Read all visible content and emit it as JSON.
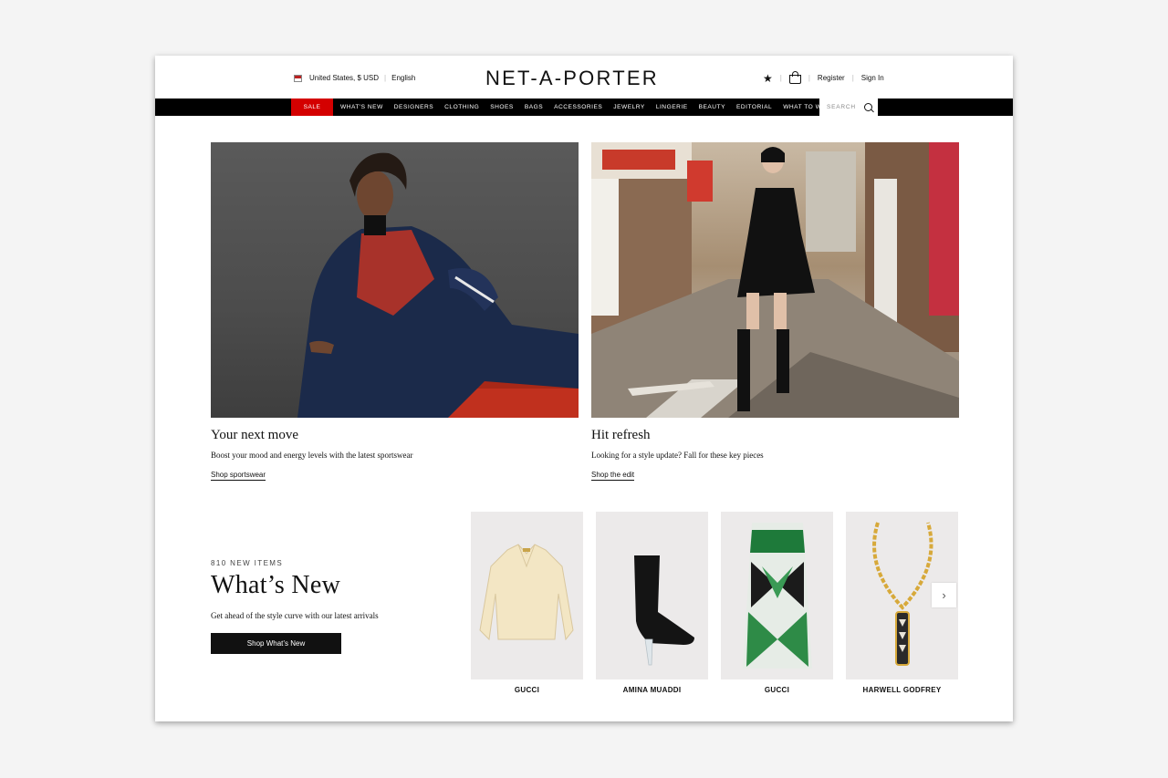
{
  "header": {
    "locale": "United States, $ USD",
    "language": "English",
    "logo": "NET-A-PORTER",
    "register": "Register",
    "sign_in": "Sign In"
  },
  "nav": {
    "items": [
      "SALE",
      "WHAT'S NEW",
      "DESIGNERS",
      "CLOTHING",
      "SHOES",
      "BAGS",
      "ACCESSORIES",
      "JEWELRY",
      "LINGERIE",
      "BEAUTY",
      "EDITORIAL",
      "WHAT TO WEAR"
    ],
    "search_placeholder": "SEARCH"
  },
  "heroes": [
    {
      "title": "Your next move",
      "subtitle": "Boost your mood and energy levels with the latest sportswear",
      "link": "Shop sportswear"
    },
    {
      "title": "Hit refresh",
      "subtitle": "Looking for a style update? Fall for these key pieces",
      "link": "Shop the edit"
    }
  ],
  "whats_new": {
    "count": "810 NEW ITEMS",
    "title": "What’s New",
    "subtitle": "Get ahead of the style curve with our latest arrivals",
    "button": "Shop What’s New"
  },
  "products": [
    {
      "brand": "GUCCI"
    },
    {
      "brand": "AMINA MUADDI"
    },
    {
      "brand": "GUCCI"
    },
    {
      "brand": "HARWELL GODFREY"
    }
  ],
  "colors": {
    "sale": "#d40000",
    "nav": "#000000"
  }
}
